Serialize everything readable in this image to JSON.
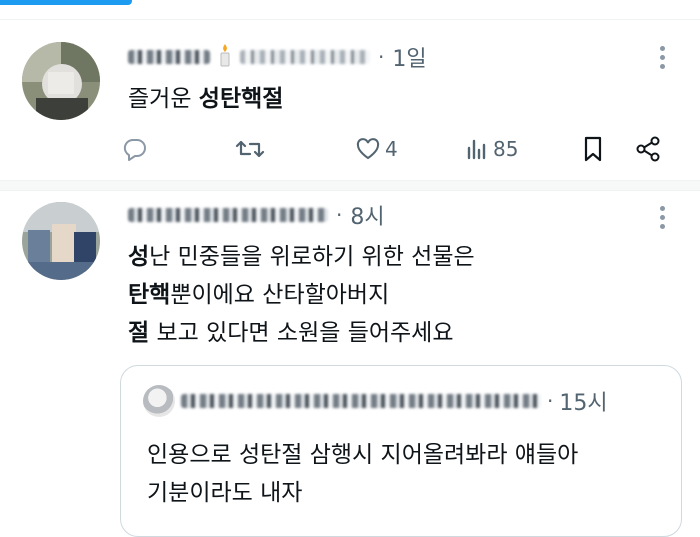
{
  "tweets": [
    {
      "time": "1일",
      "body_plain": "즐거운 ",
      "body_bold": "성탄핵절",
      "replies": "",
      "retweets": "",
      "likes": "4",
      "views": "85"
    },
    {
      "time": "8시",
      "lines": [
        {
          "bold": "성",
          "rest": "난 민중들을 위로하기 위한 선물은"
        },
        {
          "bold": "탄핵",
          "rest": "뿐이에요 산타할아버지"
        },
        {
          "bold": "절",
          "rest": " 보고 있다면 소원을 들어주세요"
        }
      ],
      "quote": {
        "time": "15시",
        "line1": "인용으로 성탄절 삼행시 지어올려봐라 얘들아",
        "line2": "기분이라도 내자"
      }
    }
  ],
  "colors": {
    "accent": "#1d9bf0",
    "text": "#0f1419",
    "muted": "#536471",
    "border": "#cfd9de"
  }
}
